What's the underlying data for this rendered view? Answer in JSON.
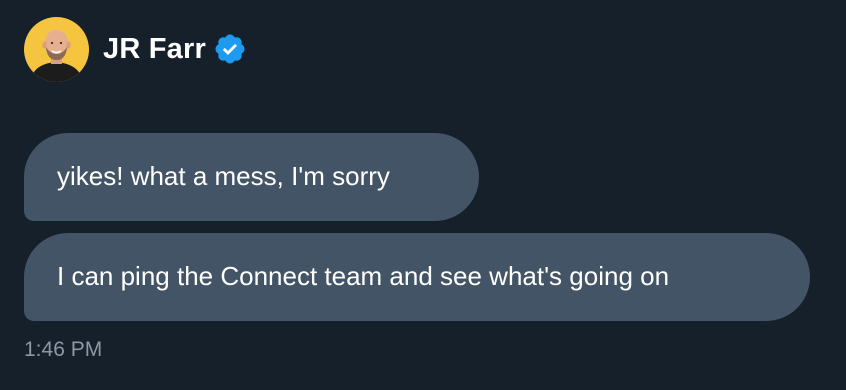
{
  "conversation": {
    "sender": {
      "name": "JR Farr",
      "verified": true,
      "avatar_icon": "avatar-photo",
      "avatar_background": "#f6c540",
      "verified_color": "#1d9bf0"
    },
    "messages": [
      {
        "text": "yikes! what a mess, I'm sorry"
      },
      {
        "text": "I can ping the Connect team and see what's going on"
      }
    ],
    "timestamp": "1:46 PM"
  },
  "theme": {
    "background": "#15202b",
    "bubble": "#425466",
    "text": "#ffffff",
    "muted": "#8b98a5"
  }
}
